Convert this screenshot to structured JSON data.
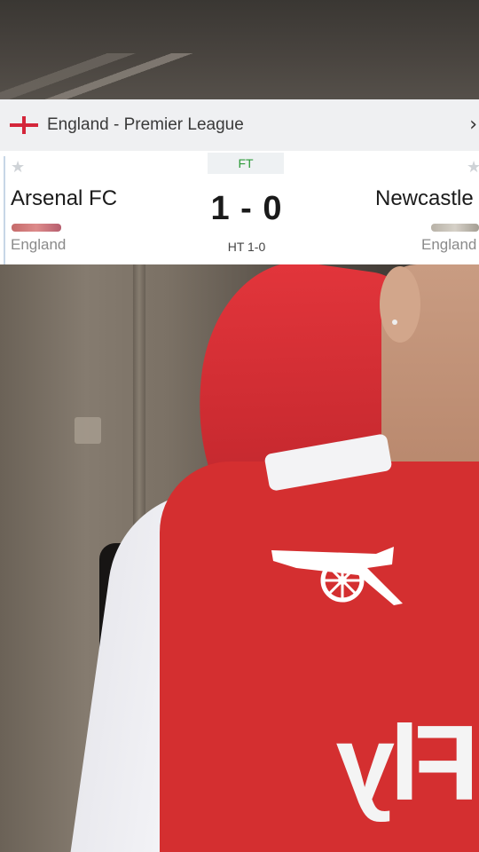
{
  "league": {
    "flag_icon": "england-flag-icon",
    "name": "England - Premier League",
    "chevron": "›"
  },
  "match": {
    "status": "FT",
    "home_team": {
      "name": "Arsenal FC",
      "country": "England"
    },
    "away_team": {
      "name": "Newcastle",
      "country": "England"
    },
    "score": "1 - 0",
    "halftime": "HT 1-0",
    "favorite_icon": "star-icon"
  },
  "background": {
    "sponsor_text": "Fly"
  },
  "colors": {
    "status_green": "#2e9a3a",
    "flag_red": "#d4263a",
    "jersey_red": "#d42f30"
  }
}
